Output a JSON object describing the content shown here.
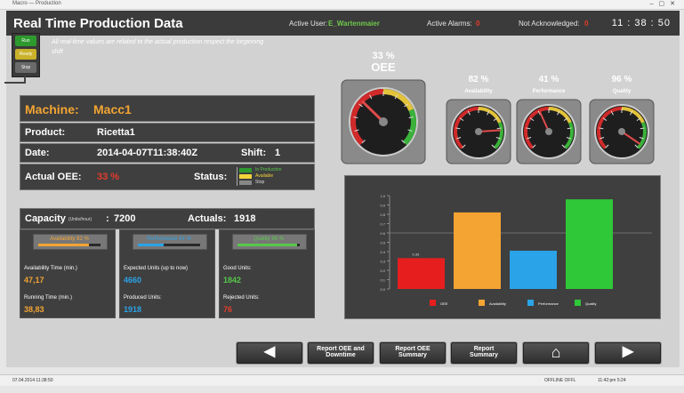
{
  "window": {
    "title": "Macro — Production"
  },
  "header": {
    "title": "Real Time Production Data",
    "active_user_label": "Active User:",
    "active_user": "E_Wartenmaier",
    "alarms_label": "Active Alarms:",
    "alarms": "0",
    "not_ack_label": "Not Acknowledged:",
    "not_ack": "0",
    "clock": "11 : 38 : 50"
  },
  "lights": [
    "Run",
    "Ready",
    "Stop"
  ],
  "note": "All real-time values are related to the actual production respect the beginning shift",
  "machine": {
    "label": "Machine:",
    "name": "Macc1",
    "product_label": "Product:",
    "product": "Ricetta1",
    "date_label": "Date:",
    "date": "2014-04-07T11:38:40Z",
    "shift_label": "Shift:",
    "shift": "1",
    "oee_label": "Actual OEE:",
    "oee": "33 %",
    "status_label": "Status:",
    "status_items": [
      "In Production",
      "Available",
      "Stop"
    ]
  },
  "capacity": {
    "label": "Capacity",
    "unit": "(Units/hour)",
    "value": "7200",
    "actuals_label": "Actuals:",
    "actuals": "1918"
  },
  "stats": [
    {
      "bar_label": "Availability",
      "bar_value": "82 %",
      "bar_color": "#f3a433",
      "t1": "Availability Time (min.)",
      "v1": "47,17",
      "t2": "Running Time (min.)",
      "v2": "38,83",
      "v_color": "#f3a433",
      "fill": 0.82
    },
    {
      "bar_label": "Performance",
      "bar_value": "41 %",
      "bar_color": "#2aa3e8",
      "t1": "Expected Units (up to now)",
      "v1": "4660",
      "t2": "Produced Units:",
      "v2": "1918",
      "v_color": "#2aa3e8",
      "fill": 0.41
    },
    {
      "bar_label": "Quality",
      "bar_value": "96 %",
      "bar_color": "#57c84a",
      "t1": "Good Units:",
      "v1": "1842",
      "t2": "Rejected Units:",
      "v2": "76",
      "v_color": "#57c84a",
      "v2_color": "#e53b2b",
      "fill": 0.96
    }
  ],
  "gauges": [
    {
      "name": "OEE",
      "value": "33 %",
      "level": 0.33
    },
    {
      "name": "Availability",
      "value": "82 %",
      "level": 0.82
    },
    {
      "name": "Performance",
      "value": "41 %",
      "level": 0.41
    },
    {
      "name": "Quality",
      "value": "96 %",
      "level": 0.96
    }
  ],
  "chart_data": {
    "type": "bar",
    "categories": [
      "OEE",
      "Availability",
      "Performance",
      "Quality"
    ],
    "values": [
      0.33,
      0.82,
      0.41,
      0.96
    ],
    "colors": [
      "#e61e1e",
      "#f3a433",
      "#2aa3e8",
      "#2ec838"
    ],
    "ylim": [
      0,
      1.0
    ],
    "yticks": [
      "1.0",
      "0.9",
      "0.8",
      "0.7",
      "0.6",
      "0.5",
      "0.4",
      "0.3",
      "0.2",
      "0.1",
      "0.0"
    ],
    "data_labels": [
      "0.33",
      "",
      "",
      ""
    ]
  },
  "nav": {
    "back": "◀",
    "report_oee_downtime": [
      "Report OEE and",
      "Downtime"
    ],
    "report_oee_summary": [
      "Report OEE",
      "Summary"
    ],
    "report_summary": [
      "Report",
      "Summary"
    ],
    "home": "⌂",
    "forward": "▶"
  },
  "statusbar": {
    "left": "07.04.2014 11:38:50",
    "mid": "OFFLINE OFFL",
    "right": "11:42:pm 5:24"
  }
}
